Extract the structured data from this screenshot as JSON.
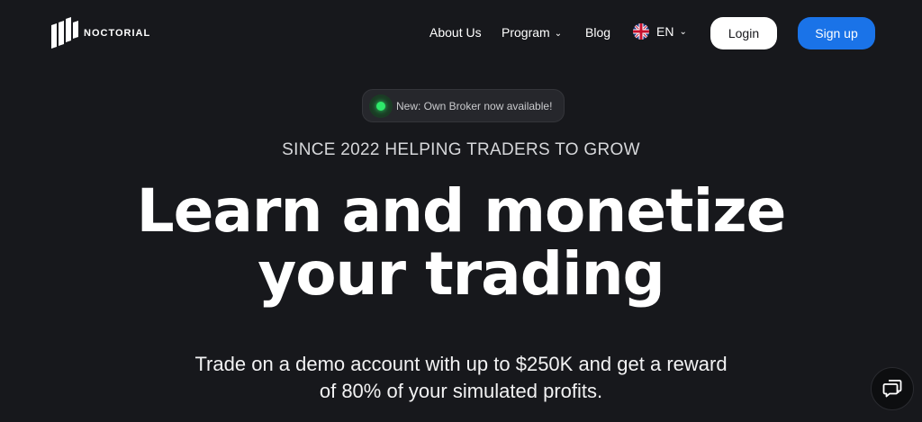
{
  "brand": {
    "name": "NOCTORIAL"
  },
  "nav": {
    "about": "About Us",
    "program": "Program",
    "blog": "Blog",
    "language": "EN"
  },
  "auth": {
    "login": "Login",
    "signup": "Sign up"
  },
  "hero": {
    "badge": "New: Own Broker now available!",
    "kicker": "SINCE 2022 HELPING TRADERS TO GROW",
    "headline_line1": "Learn and monetize",
    "headline_line2": "your trading",
    "subline_line1": "Trade on a demo account with up to $250K and get a reward",
    "subline_line2": "of 80% of your simulated profits."
  },
  "colors": {
    "background": "#17181c",
    "accent_blue": "#1a73e8",
    "status_green": "#2ee86a"
  },
  "icons": [
    "logo-mark-icon",
    "chevron-down-icon",
    "uk-flag-icon",
    "status-dot-icon",
    "chat-icon"
  ]
}
